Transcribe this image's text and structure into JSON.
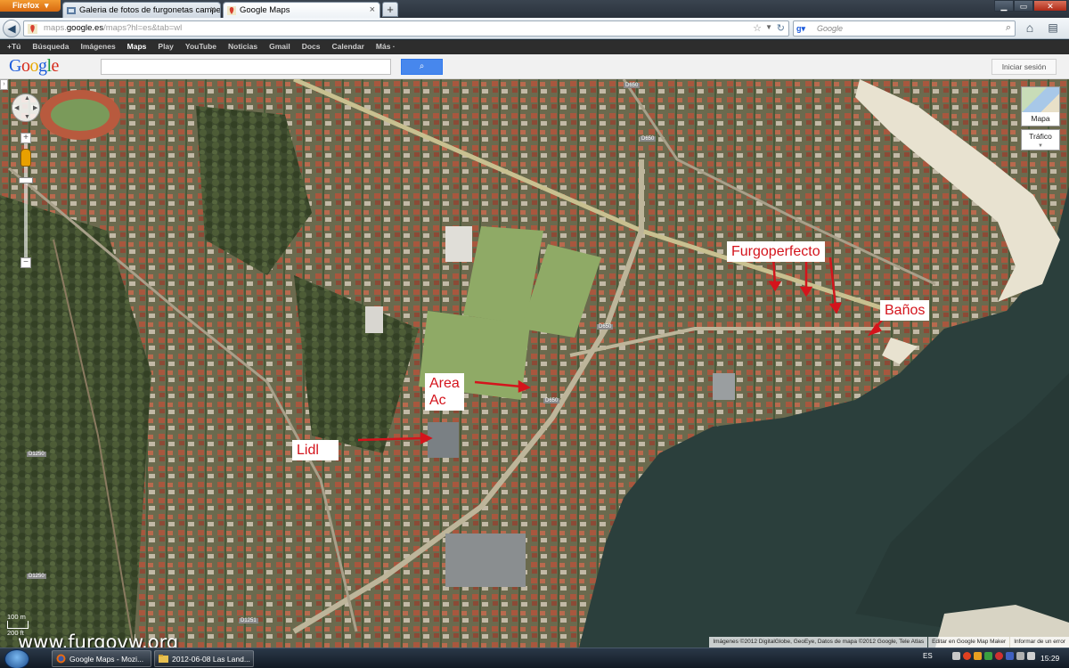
{
  "browser": {
    "menu_label": "Firefox",
    "tabs": [
      {
        "title": "Galeria de fotos de furgonetas campe...",
        "active": false
      },
      {
        "title": "Google Maps",
        "active": true
      }
    ],
    "new_tab": "+",
    "close_glyph": "×",
    "url_prefix": "maps.",
    "url_domain": "google.es",
    "url_suffix": "/maps?hl=es&tab=wl",
    "search_placeholder": "Google"
  },
  "gbar": {
    "items": [
      {
        "label": "+Tú",
        "active": false
      },
      {
        "label": "Búsqueda",
        "active": false
      },
      {
        "label": "Imágenes",
        "active": false
      },
      {
        "label": "Maps",
        "active": true
      },
      {
        "label": "Play",
        "active": false
      },
      {
        "label": "YouTube",
        "active": false
      },
      {
        "label": "Noticias",
        "active": false
      },
      {
        "label": "Gmail",
        "active": false
      },
      {
        "label": "Docs",
        "active": false
      },
      {
        "label": "Calendar",
        "active": false
      },
      {
        "label": "Más ·",
        "active": false
      }
    ]
  },
  "google": {
    "logo_letters": [
      "G",
      "o",
      "o",
      "g",
      "l",
      "e"
    ],
    "search_value": "",
    "signin_label": "Iniciar sesión"
  },
  "map": {
    "map_type_label": "Mapa",
    "traffic_label": "Tráfico",
    "scale_top": "100 m",
    "scale_bottom": "200 ft",
    "road_labels": [
      "D650",
      "D650",
      "D650",
      "D650",
      "D1250",
      "D1250",
      "D1251"
    ],
    "annotations": {
      "furgoperfecto": "Furgoperfecto",
      "banos": "Baños",
      "area_ac_line1": "Area",
      "area_ac_line2": "Ac",
      "lidl": "Lidl"
    },
    "watermark": "www.furgovw.org",
    "attribution": [
      "Imágenes ©2012 DigitalGlobe, GeoEye, Datos de mapa ©2012 Google, Tele Atlas",
      "Editar en Google Map Maker",
      "Informar de un error"
    ],
    "colors": {
      "annotation_red": "#d4141c",
      "water": "#2b3f3c",
      "beach": "#e8e2d0"
    }
  },
  "taskbar": {
    "tasks": [
      {
        "title": "Google Maps - Mozi..."
      },
      {
        "title": "2012-06-08 Las Land..."
      }
    ],
    "language": "ES",
    "time": "15:29"
  }
}
